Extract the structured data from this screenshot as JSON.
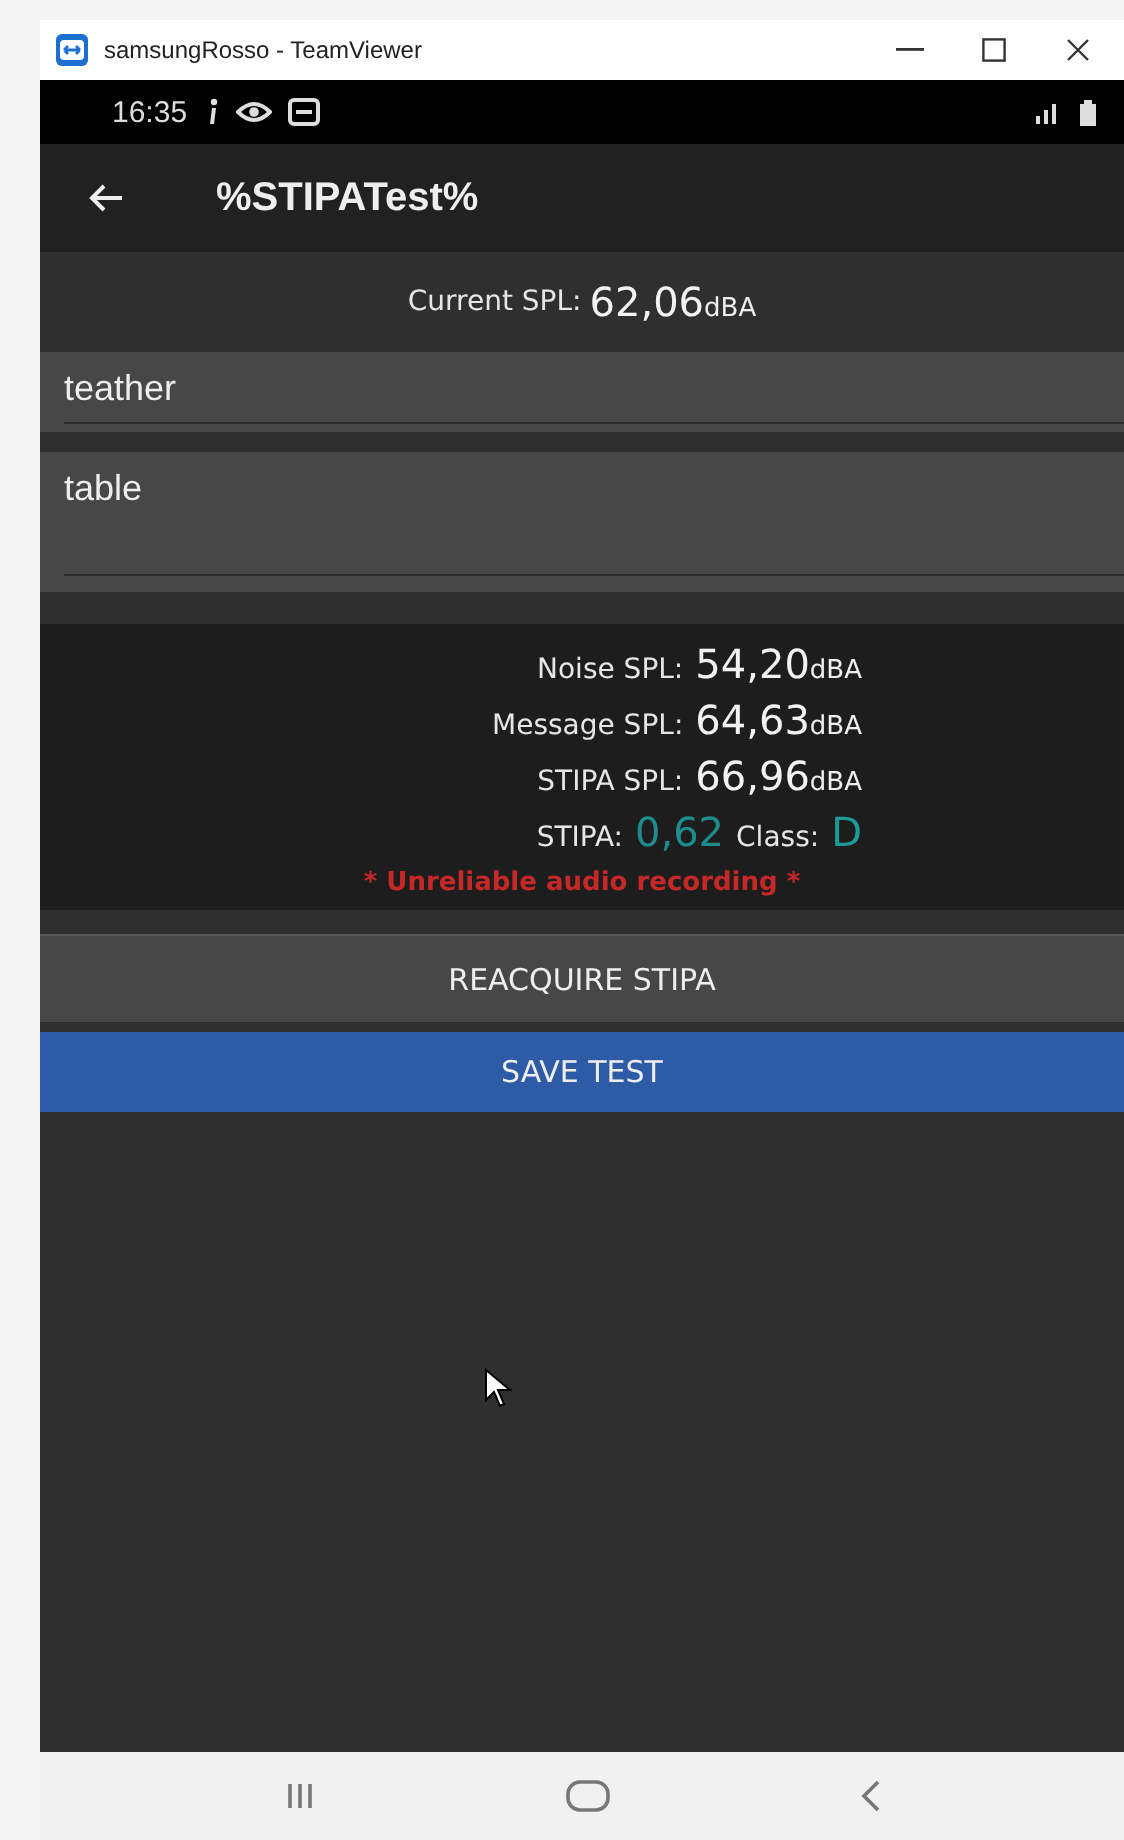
{
  "window": {
    "title": "samsungRosso - TeamViewer"
  },
  "status_bar": {
    "time": "16:35"
  },
  "app_bar": {
    "title": "%STIPATest%"
  },
  "current_spl": {
    "label": "Current SPL:",
    "value": "62,06",
    "unit": "dBA"
  },
  "fields": [
    {
      "value": "teather",
      "kind": "single"
    },
    {
      "value": "table",
      "kind": "multi"
    }
  ],
  "results": [
    {
      "label": "Noise SPL:",
      "value": "54,20",
      "unit": "dBA"
    },
    {
      "label": "Message SPL:",
      "value": "64,63",
      "unit": "dBA"
    },
    {
      "label": "STIPA SPL:",
      "value": "66,96",
      "unit": "dBA"
    }
  ],
  "stipa": {
    "label": "STIPA:",
    "value": "0,62",
    "class_label": "Class:",
    "class_value": "D"
  },
  "warning": "* Unreliable audio recording *",
  "buttons": [
    {
      "label": "REACQUIRE STIPA",
      "kind": "secondary"
    },
    {
      "label": "SAVE TEST",
      "kind": "primary"
    }
  ]
}
